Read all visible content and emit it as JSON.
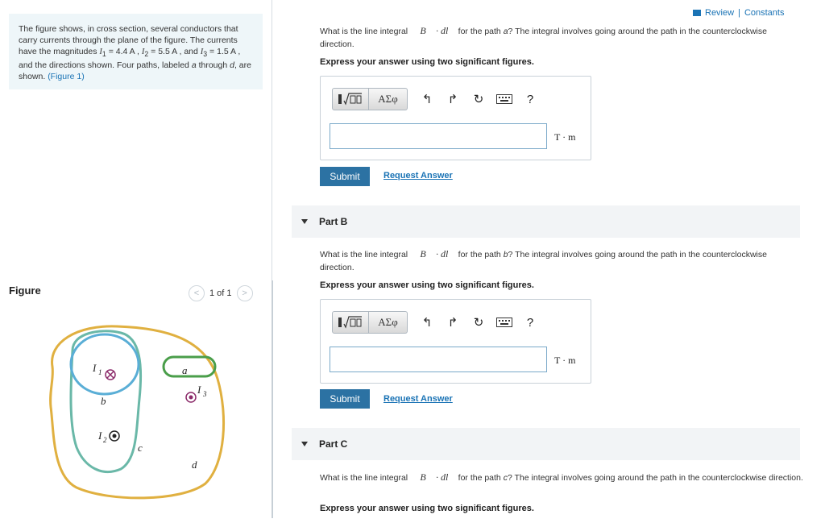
{
  "intro": {
    "text_1": "The figure shows, in cross section, several conductors that carry currents through the plane of the figure. The currents have the magnitudes ",
    "i1": "I",
    "i1_sub": "1",
    "i1_val": " = 4.4 A , ",
    "i2": "I",
    "i2_sub": "2",
    "i2_val": " = 5.5 A ,",
    "text_and": " and ",
    "i3": "I",
    "i3_sub": "3",
    "i3_val": " = 1.5 A , and the directions shown. Four paths, labeled ",
    "a": "a",
    "through": " through ",
    "d": "d",
    "text_end": ", are shown. ",
    "figure_link": "(Figure 1)"
  },
  "figure": {
    "title": "Figure",
    "pager_text": "1 of 1",
    "prev_icon": "chevron-left",
    "next_icon": "chevron-right",
    "labels": {
      "I1": "I",
      "I1_sub": "1",
      "I2": "I",
      "I2_sub": "2",
      "I3": "I",
      "I3_sub": "3",
      "a": "a",
      "b": "b",
      "c": "c",
      "d": "d"
    },
    "colors": {
      "path_a": "#4a9e4a",
      "path_b": "#5aaed6",
      "path_c": "#6ab8a8",
      "path_d": "#e0b040",
      "conductor": "#8b2b6a"
    }
  },
  "header": {
    "review": "Review",
    "sep": " | ",
    "constants": "Constants"
  },
  "parts": [
    {
      "id": "A",
      "header": "",
      "question_pre": "What is the line integral ",
      "math": "∮ B⃗ · dl⃗",
      "question_post_pre": " for the path ",
      "path": "a",
      "question_post": "? The integral involves going around the path in the counterclockwise direction.",
      "express": "Express your answer using two significant figures.",
      "unit": "T · m",
      "submit": "Submit",
      "request": "Request Answer"
    },
    {
      "id": "B",
      "header": "Part B",
      "question_pre": "What is the line integral ",
      "math": "∮ B⃗ · dl⃗",
      "question_post_pre": " for the path ",
      "path": "b",
      "question_post": "? The integral involves going around the path in the counterclockwise direction.",
      "express": "Express your answer using two significant figures.",
      "unit": "T · m",
      "submit": "Submit",
      "request": "Request Answer"
    },
    {
      "id": "C",
      "header": "Part C",
      "question_pre": "What is the line integral ",
      "math": "∮ B⃗ · dl⃗",
      "question_post_pre": " for the path ",
      "path": "c",
      "question_post": "? The integral involves going around the path in the counterclockwise direction.",
      "express": "Express your answer using two significant figures."
    }
  ],
  "toolbar": {
    "greek": "ΑΣφ",
    "help": "?",
    "icons": [
      "templates-icon",
      "greek-icon",
      "undo-icon",
      "redo-icon",
      "reset-icon",
      "keyboard-icon",
      "help-icon"
    ]
  }
}
